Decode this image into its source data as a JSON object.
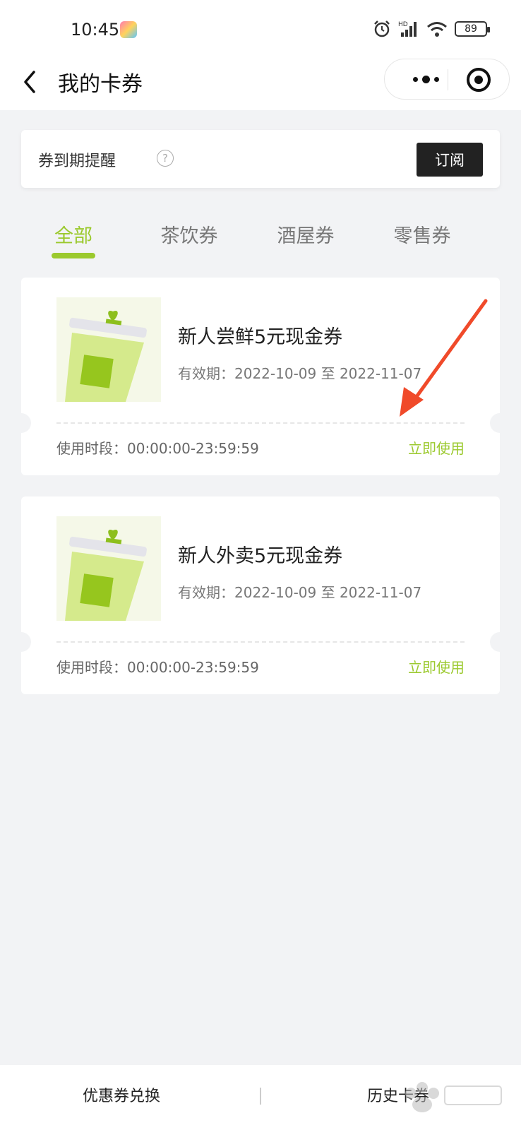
{
  "status_bar": {
    "time": "10:45",
    "battery": "89",
    "signal_label": "HD"
  },
  "navbar": {
    "title": "我的卡券"
  },
  "reminder": {
    "text": "券到期提醒",
    "help": "?",
    "subscribe_label": "订阅"
  },
  "tabs": [
    {
      "label": "全部",
      "active": true
    },
    {
      "label": "茶饮券",
      "active": false
    },
    {
      "label": "酒屋券",
      "active": false
    },
    {
      "label": "零售券",
      "active": false
    }
  ],
  "coupons": [
    {
      "name": "新人尝鲜5元现金券",
      "validity": "有效期：2022-10-09 至 2022-11-07",
      "period": "使用时段：00:00:00-23:59:59",
      "action": "立即使用"
    },
    {
      "name": "新人外卖5元现金券",
      "validity": "有效期：2022-10-09 至 2022-11-07",
      "period": "使用时段：00:00:00-23:59:59",
      "action": "立即使用"
    }
  ],
  "bottom_bar": {
    "exchange_label": "优惠券兑换",
    "history_label": "历史卡券"
  },
  "colors": {
    "accent": "#9bc92d",
    "button_dark": "#222222",
    "annotation_arrow": "#f04a2a"
  }
}
